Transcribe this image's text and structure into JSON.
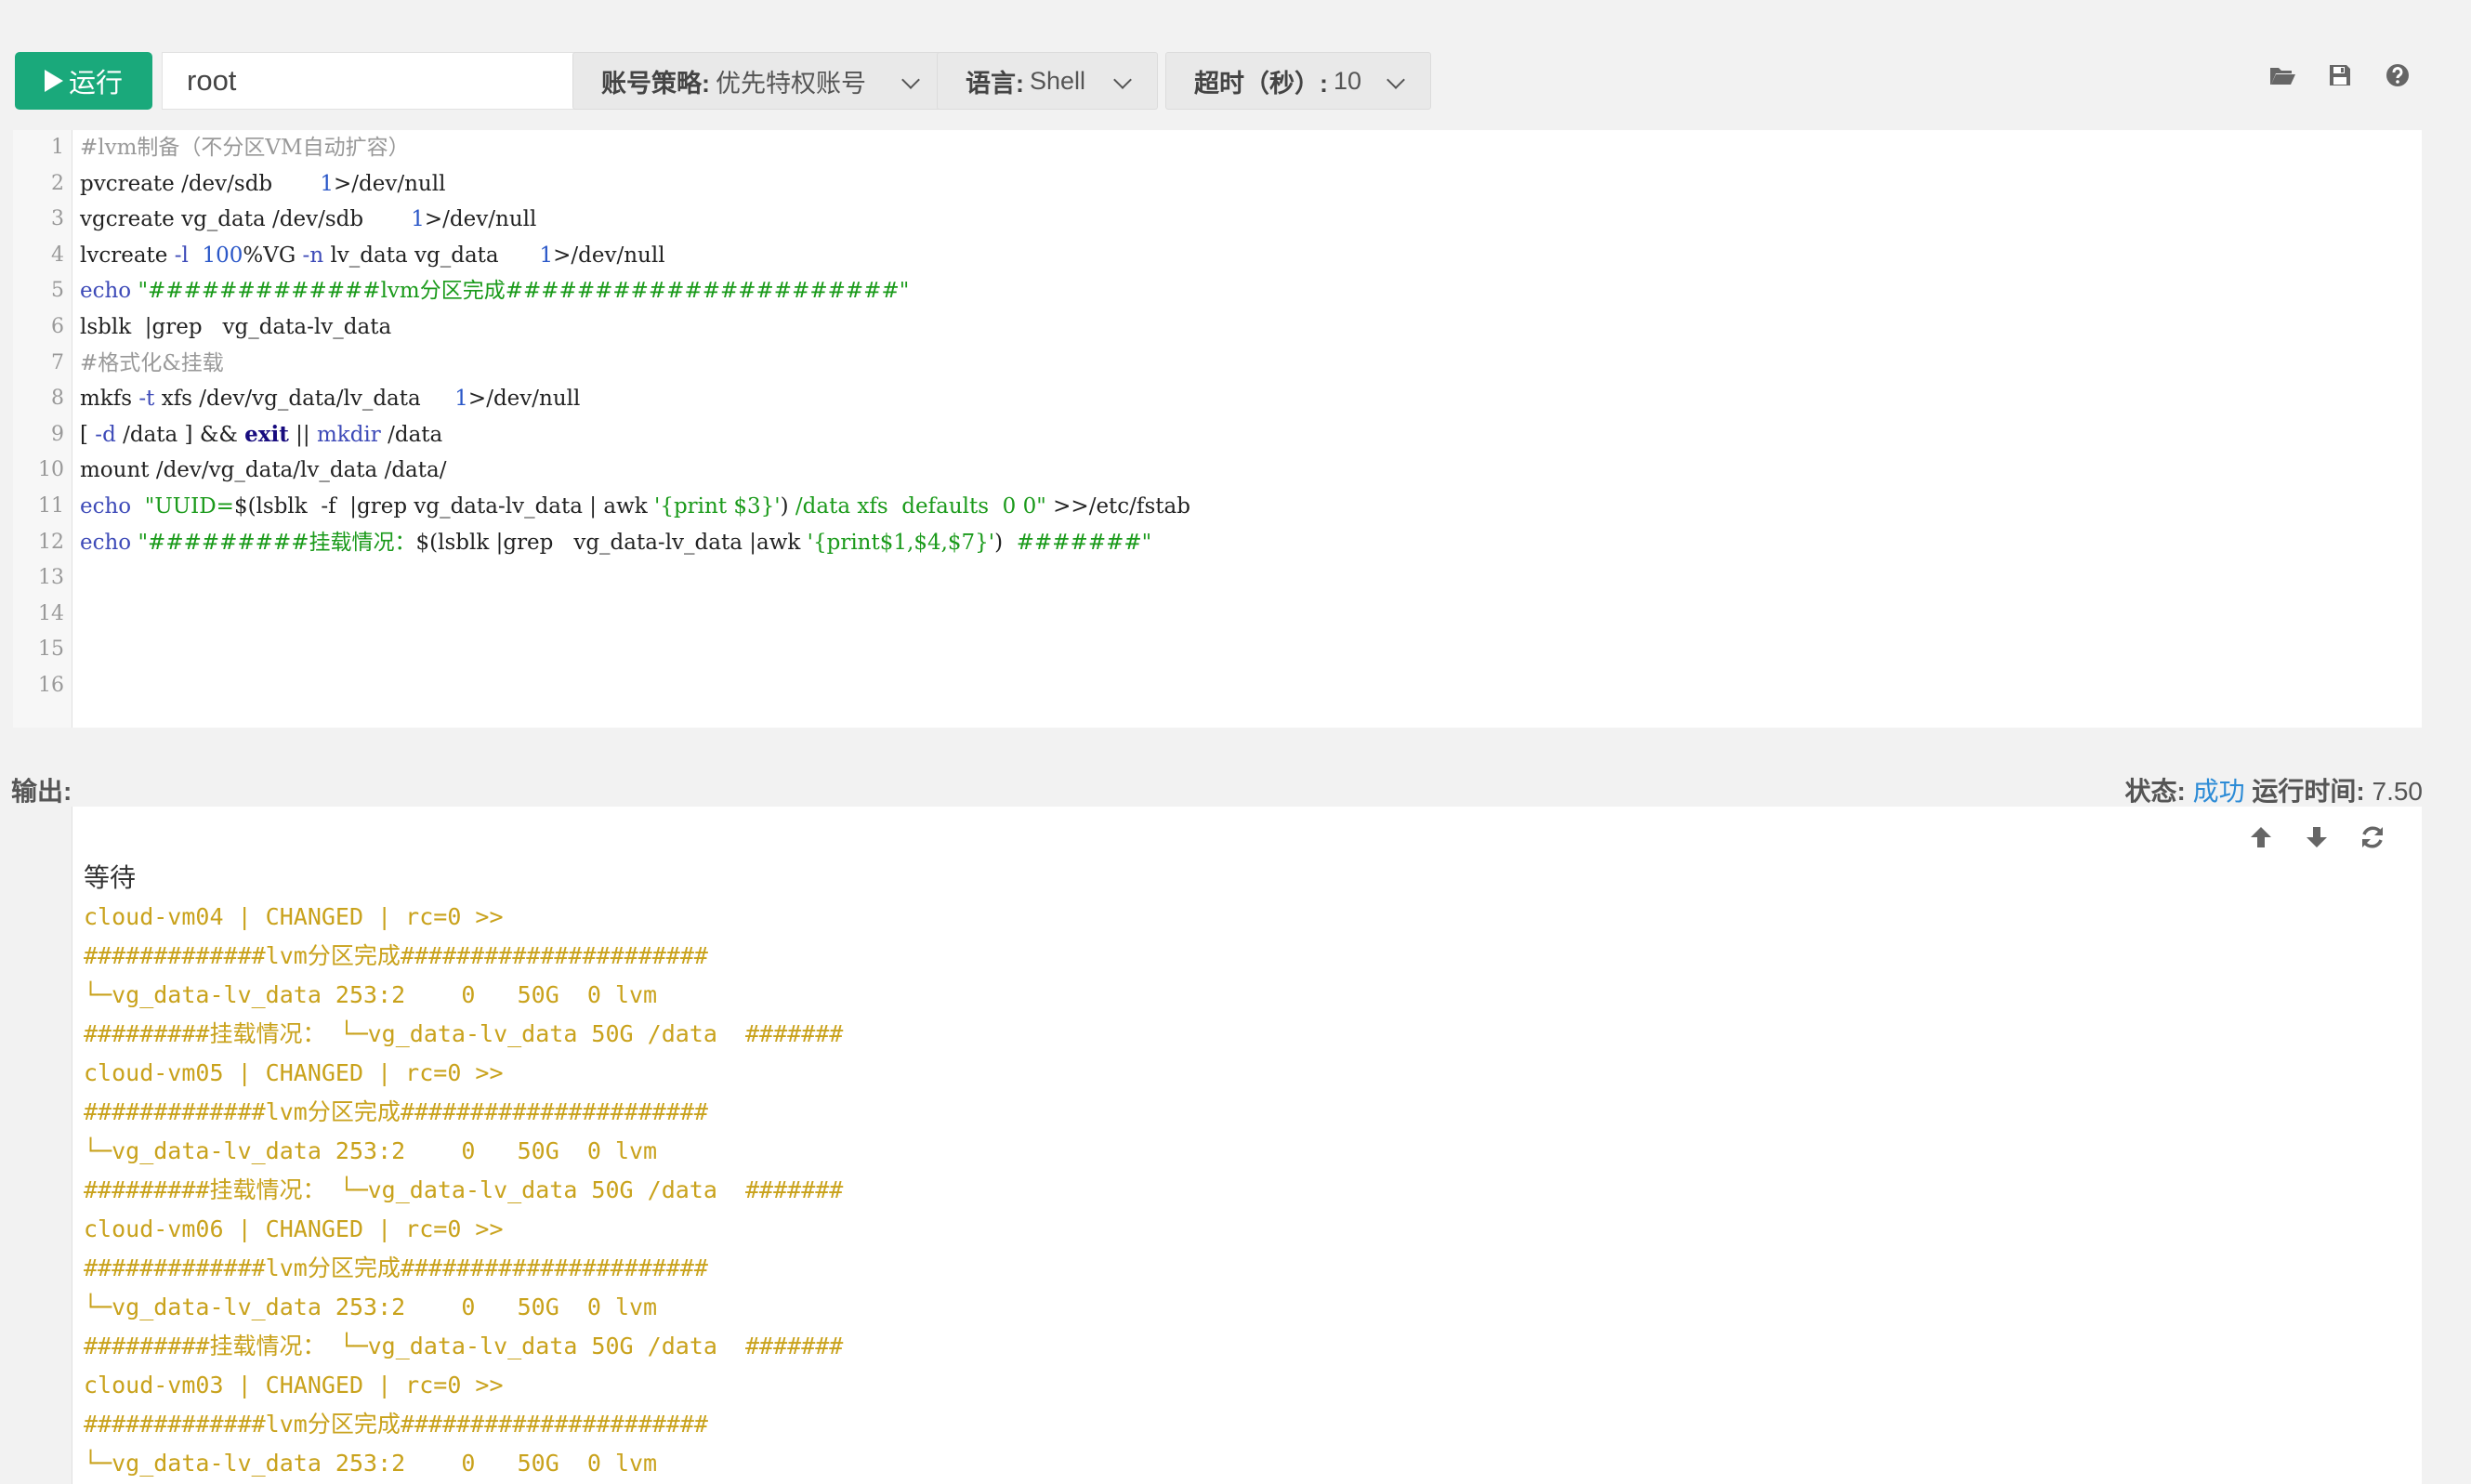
{
  "toolbar": {
    "run_label": "运行",
    "user_value": "root",
    "account_label": "账号策略:",
    "account_value": "优先特权账号",
    "lang_label": "语言:",
    "lang_value": "Shell",
    "timeout_label": "超时（秒）:",
    "timeout_value": "10"
  },
  "editor": {
    "line_numbers": [
      "1",
      "2",
      "3",
      "4",
      "5",
      "6",
      "7",
      "8",
      "9",
      "10",
      "11",
      "12",
      "13",
      "14",
      "15",
      "16"
    ],
    "lines": [
      [
        {
          "c": "cm",
          "t": "#lvm制备（不分区VM自动扩容）"
        }
      ],
      [
        {
          "c": "",
          "t": "pvcreate /dev/sdb       "
        },
        {
          "c": "nb",
          "t": "1"
        },
        {
          "c": "",
          "t": ">/dev/null"
        }
      ],
      [
        {
          "c": "",
          "t": "vgcreate vg_data /dev/sdb       "
        },
        {
          "c": "nb",
          "t": "1"
        },
        {
          "c": "",
          "t": ">/dev/null"
        }
      ],
      [
        {
          "c": "",
          "t": "lvcreate "
        },
        {
          "c": "kw",
          "t": "-l"
        },
        {
          "c": "",
          "t": "  "
        },
        {
          "c": "nb",
          "t": "100"
        },
        {
          "c": "",
          "t": "%VG "
        },
        {
          "c": "kw",
          "t": "-n"
        },
        {
          "c": "",
          "t": " lv_data vg_data      "
        },
        {
          "c": "nb",
          "t": "1"
        },
        {
          "c": "",
          "t": ">/dev/null"
        }
      ],
      [
        {
          "c": "kw",
          "t": "echo"
        },
        {
          "c": "",
          "t": " "
        },
        {
          "c": "st",
          "t": "\"#############lvm分区完成######################\""
        }
      ],
      [
        {
          "c": "",
          "t": "lsblk  |grep   vg_data-lv_data"
        }
      ],
      [
        {
          "c": "cm",
          "t": "#格式化&挂载"
        }
      ],
      [
        {
          "c": "",
          "t": "mkfs "
        },
        {
          "c": "kw",
          "t": "-t"
        },
        {
          "c": "",
          "t": " xfs /dev/vg_data/lv_data     "
        },
        {
          "c": "nb",
          "t": "1"
        },
        {
          "c": "",
          "t": ">/dev/null"
        }
      ],
      [
        {
          "c": "",
          "t": "[ "
        },
        {
          "c": "kw",
          "t": "-d"
        },
        {
          "c": "",
          "t": " /data ] && "
        },
        {
          "c": "kb",
          "t": "exit"
        },
        {
          "c": "",
          "t": " || "
        },
        {
          "c": "kw",
          "t": "mkdir"
        },
        {
          "c": "",
          "t": " /data"
        }
      ],
      [
        {
          "c": "",
          "t": "mount /dev/vg_data/lv_data /data/"
        }
      ],
      [
        {
          "c": "kw",
          "t": "echo"
        },
        {
          "c": "",
          "t": "  "
        },
        {
          "c": "st",
          "t": "\"UUID="
        },
        {
          "c": "",
          "t": "$(lsblk  -f  |grep vg_data-lv_data | awk "
        },
        {
          "c": "st",
          "t": "'{print $3}'"
        },
        {
          "c": "",
          "t": ") "
        },
        {
          "c": "st",
          "t": "/data xfs  defaults  0 0\""
        },
        {
          "c": "",
          "t": " >>/etc/fstab"
        }
      ],
      [
        {
          "c": "kw",
          "t": "echo"
        },
        {
          "c": "",
          "t": " "
        },
        {
          "c": "st",
          "t": "\"#########挂载情况："
        },
        {
          "c": "",
          "t": "$(lsblk |grep   vg_data-lv_data |awk "
        },
        {
          "c": "st",
          "t": "'{print$1,$4,$7}'"
        },
        {
          "c": "",
          "t": ")  "
        },
        {
          "c": "st",
          "t": "#######\""
        }
      ],
      [],
      [],
      [],
      []
    ]
  },
  "output": {
    "label": "输出:",
    "status_label": "状态:",
    "status_value": "成功",
    "runtime_label": "运行时间:",
    "runtime_value": "7.50",
    "wait_text": "等待",
    "lines": [
      "cloud-vm04 | CHANGED | rc=0 >>",
      "#############lvm分区完成######################",
      "└─vg_data-lv_data 253:2    0   50G  0 lvm",
      "#########挂载情况： └─vg_data-lv_data 50G /data  #######",
      "cloud-vm05 | CHANGED | rc=0 >>",
      "#############lvm分区完成######################",
      "└─vg_data-lv_data 253:2    0   50G  0 lvm",
      "#########挂载情况： └─vg_data-lv_data 50G /data  #######",
      "cloud-vm06 | CHANGED | rc=0 >>",
      "#############lvm分区完成######################",
      "└─vg_data-lv_data 253:2    0   50G  0 lvm",
      "#########挂载情况： └─vg_data-lv_data 50G /data  #######",
      "cloud-vm03 | CHANGED | rc=0 >>",
      "#############lvm分区完成######################",
      "└─vg_data-lv_data 253:2    0   50G  0 lvm"
    ]
  },
  "icons": {
    "open": "folder-open-icon",
    "save": "save-icon",
    "help": "help-icon",
    "up": "arrow-up-icon",
    "down": "arrow-down-icon",
    "refresh": "refresh-icon"
  }
}
